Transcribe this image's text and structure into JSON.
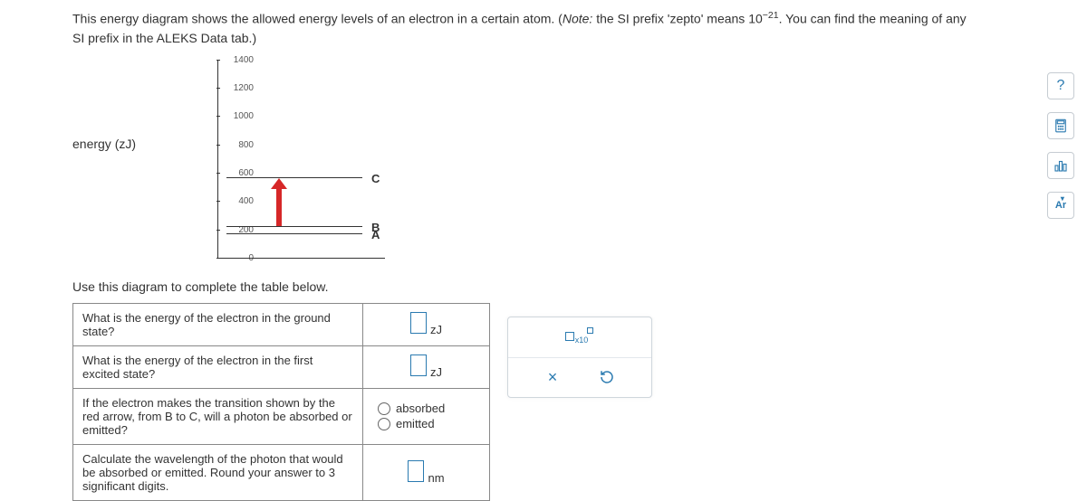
{
  "prompt": {
    "line1_a": "This energy diagram shows the allowed energy levels of an electron in a certain atom. (",
    "note_label": "Note:",
    "line1_b": " the SI prefix 'zepto' means ",
    "base": "10",
    "exp": "−21",
    "line1_c": ". You can find the meaning of any SI prefix in the ALEKS Data tab.)"
  },
  "diagram": {
    "ylabel": "energy (zJ)",
    "yticks": [
      "1400",
      "1200",
      "1000",
      "800",
      "600",
      "400",
      "200",
      "0"
    ],
    "levels": {
      "A": 180,
      "B": 230,
      "C": 570
    },
    "arrow": {
      "from": "B",
      "to": "C"
    }
  },
  "instruction": "Use this diagram to complete the table below.",
  "rows": {
    "r1": {
      "q": "What is the energy of the electron in the ground state?",
      "unit": "zJ"
    },
    "r2": {
      "q": "What is the energy of the electron in the first excited state?",
      "unit": "zJ"
    },
    "r3": {
      "q": "If the electron makes the transition shown by the red arrow, from B to C, will a photon be absorbed or emitted?",
      "opt1": "absorbed",
      "opt2": "emitted"
    },
    "r4": {
      "q": "Calculate the wavelength of the photon that would be absorbed or emitted. Round your answer to 3 significant digits.",
      "unit": "nm"
    }
  },
  "palette": {
    "sci_label": "x10",
    "clear": "×",
    "reset": "↺"
  },
  "chart_data": {
    "type": "bar",
    "categories": [
      "A",
      "B",
      "C"
    ],
    "values": [
      180,
      230,
      570
    ],
    "title": "",
    "xlabel": "",
    "ylabel": "energy (zJ)",
    "ylim": [
      0,
      1400
    ]
  }
}
